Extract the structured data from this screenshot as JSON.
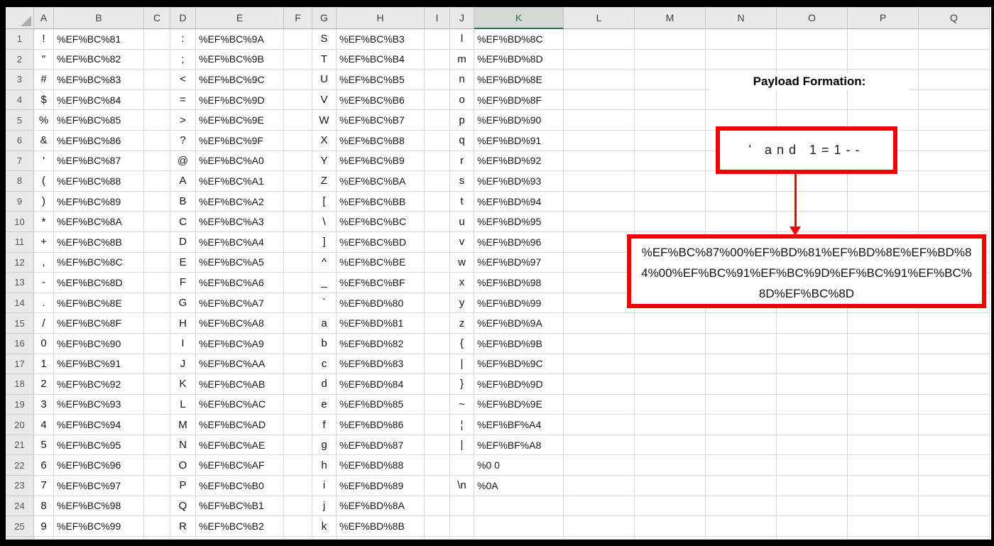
{
  "column_headers": [
    "A",
    "B",
    "C",
    "D",
    "E",
    "F",
    "G",
    "H",
    "I",
    "J",
    "K",
    "L",
    "M",
    "N",
    "O",
    "P",
    "Q"
  ],
  "selected_column": "K",
  "rows": [
    {
      "n": "1",
      "a": "!",
      "b": "%EF%BC%81",
      "d": ":",
      "e": "%EF%BC%9A",
      "g": "S",
      "h": "%EF%BC%B3",
      "j": "l",
      "k": "%EF%BD%8C"
    },
    {
      "n": "2",
      "a": "\"",
      "b": "%EF%BC%82",
      "d": ";",
      "e": "%EF%BC%9B",
      "g": "T",
      "h": "%EF%BC%B4",
      "j": "m",
      "k": "%EF%BD%8D"
    },
    {
      "n": "3",
      "a": "#",
      "b": "%EF%BC%83",
      "d": "<",
      "e": "%EF%BC%9C",
      "g": "U",
      "h": "%EF%BC%B5",
      "j": "n",
      "k": "%EF%BD%8E"
    },
    {
      "n": "4",
      "a": "$",
      "b": "%EF%BC%84",
      "d": "=",
      "e": "%EF%BC%9D",
      "g": "V",
      "h": "%EF%BC%B6",
      "j": "o",
      "k": "%EF%BD%8F"
    },
    {
      "n": "5",
      "a": "%",
      "b": "%EF%BC%85",
      "d": ">",
      "e": "%EF%BC%9E",
      "g": "W",
      "h": "%EF%BC%B7",
      "j": "p",
      "k": "%EF%BD%90"
    },
    {
      "n": "6",
      "a": "&",
      "b": "%EF%BC%86",
      "d": "?",
      "e": "%EF%BC%9F",
      "g": "X",
      "h": "%EF%BC%B8",
      "j": "q",
      "k": "%EF%BD%91"
    },
    {
      "n": "7",
      "a": "'",
      "b": "%EF%BC%87",
      "d": "@",
      "e": "%EF%BC%A0",
      "g": "Y",
      "h": "%EF%BC%B9",
      "j": "r",
      "k": "%EF%BD%92"
    },
    {
      "n": "8",
      "a": "(",
      "b": "%EF%BC%88",
      "d": "A",
      "e": "%EF%BC%A1",
      "g": "Z",
      "h": "%EF%BC%BA",
      "j": "s",
      "k": "%EF%BD%93"
    },
    {
      "n": "9",
      "a": ")",
      "b": "%EF%BC%89",
      "d": "B",
      "e": "%EF%BC%A2",
      "g": "[",
      "h": "%EF%BC%BB",
      "j": "t",
      "k": "%EF%BD%94"
    },
    {
      "n": "10",
      "a": "*",
      "b": "%EF%BC%8A",
      "d": "C",
      "e": "%EF%BC%A3",
      "g": "\\",
      "h": "%EF%BC%BC",
      "j": "u",
      "k": "%EF%BD%95"
    },
    {
      "n": "11",
      "a": "+",
      "b": "%EF%BC%8B",
      "d": "D",
      "e": "%EF%BC%A4",
      "g": "]",
      "h": "%EF%BC%BD",
      "j": "v",
      "k": "%EF%BD%96"
    },
    {
      "n": "12",
      "a": ",",
      "b": "%EF%BC%8C",
      "d": "E",
      "e": "%EF%BC%A5",
      "g": "^",
      "h": "%EF%BC%BE",
      "j": "w",
      "k": "%EF%BD%97"
    },
    {
      "n": "13",
      "a": "-",
      "b": "%EF%BC%8D",
      "d": "F",
      "e": "%EF%BC%A6",
      "g": "_",
      "h": "%EF%BC%BF",
      "j": "x",
      "k": "%EF%BD%98"
    },
    {
      "n": "14",
      "a": ".",
      "b": "%EF%BC%8E",
      "d": "G",
      "e": "%EF%BC%A7",
      "g": "`",
      "h": "%EF%BD%80",
      "j": "y",
      "k": "%EF%BD%99"
    },
    {
      "n": "15",
      "a": "/",
      "b": "%EF%BC%8F",
      "d": "H",
      "e": "%EF%BC%A8",
      "g": "a",
      "h": "%EF%BD%81",
      "j": "z",
      "k": "%EF%BD%9A"
    },
    {
      "n": "16",
      "a": "0",
      "b": "%EF%BC%90",
      "d": "I",
      "e": "%EF%BC%A9",
      "g": "b",
      "h": "%EF%BD%82",
      "j": "{",
      "k": "%EF%BD%9B"
    },
    {
      "n": "17",
      "a": "1",
      "b": "%EF%BC%91",
      "d": "J",
      "e": "%EF%BC%AA",
      "g": "c",
      "h": "%EF%BD%83",
      "j": "|",
      "k": "%EF%BD%9C"
    },
    {
      "n": "18",
      "a": "2",
      "b": "%EF%BC%92",
      "d": "K",
      "e": "%EF%BC%AB",
      "g": "d",
      "h": "%EF%BD%84",
      "j": "}",
      "k": "%EF%BD%9D"
    },
    {
      "n": "19",
      "a": "3",
      "b": "%EF%BC%93",
      "d": "L",
      "e": "%EF%BC%AC",
      "g": "e",
      "h": "%EF%BD%85",
      "j": "~",
      "k": "%EF%BD%9E"
    },
    {
      "n": "20",
      "a": "4",
      "b": "%EF%BC%94",
      "d": "M",
      "e": "%EF%BC%AD",
      "g": "f",
      "h": "%EF%BD%86",
      "j": "¦",
      "k": "%EF%BF%A4"
    },
    {
      "n": "21",
      "a": "5",
      "b": "%EF%BC%95",
      "d": "N",
      "e": "%EF%BC%AE",
      "g": "g",
      "h": "%EF%BD%87",
      "j": "|",
      "k": "%EF%BF%A8"
    },
    {
      "n": "22",
      "a": "6",
      "b": "%EF%BC%96",
      "d": "O",
      "e": "%EF%BC%AF",
      "g": "h",
      "h": "%EF%BD%88",
      "j": "",
      "k": "%0 0"
    },
    {
      "n": "23",
      "a": "7",
      "b": "%EF%BC%97",
      "d": "P",
      "e": "%EF%BC%B0",
      "g": "i",
      "h": "%EF%BD%89",
      "j": "\\n",
      "k": "%0A"
    },
    {
      "n": "24",
      "a": "8",
      "b": "%EF%BC%98",
      "d": "Q",
      "e": "%EF%BC%B1",
      "g": "j",
      "h": "%EF%BD%8A",
      "j": "",
      "k": ""
    },
    {
      "n": "25",
      "a": "9",
      "b": "%EF%BC%99",
      "d": "R",
      "e": "%EF%BC%B2",
      "g": "k",
      "h": "%EF%BD%8B",
      "j": "",
      "k": ""
    }
  ],
  "annotation": {
    "title": "Payload Formation:",
    "payload_plain": "' and 1=1--",
    "payload_encoded_lines": [
      "%EF%BC%87%00%EF%BD%81%EF%BD%8E%EF%BD%8",
      "4%00%EF%BC%91%EF%BC%9D%EF%BC%91%EF%BC%",
      "8D%EF%BC%8D"
    ],
    "accent_red": "#f20000",
    "selection_green": "#217346"
  }
}
